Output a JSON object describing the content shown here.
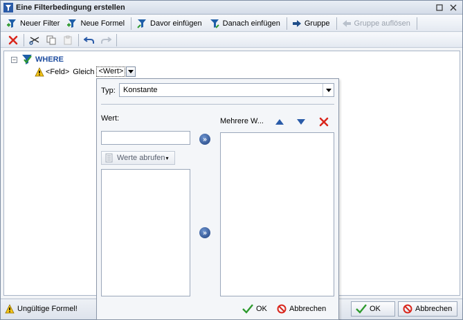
{
  "window": {
    "title": "Eine Filterbedingung erstellen",
    "restore_icon": "restore-icon",
    "close_icon": "close-icon"
  },
  "toolbar1": {
    "neuer_filter": "Neuer Filter",
    "neue_formel": "Neue Formel",
    "davor_einfuegen": "Davor einfügen",
    "danach_einfuegen": "Danach einfügen",
    "gruppe": "Gruppe",
    "gruppe_aufloesen": "Gruppe auflösen"
  },
  "toolbar2": {
    "icons": [
      "delete-icon",
      "cut-icon",
      "copy-icon",
      "paste-icon",
      "undo-icon",
      "redo-icon"
    ]
  },
  "tree": {
    "root_label": "WHERE",
    "expander": "−",
    "condition": {
      "field": "<Feld>",
      "operator": "Gleich",
      "value": "<Wert>"
    }
  },
  "popup": {
    "typ_label": "Typ:",
    "typ_value": "Konstante",
    "wert_label": "Wert:",
    "werte_abrufen": "Werte abrufen",
    "mehrere_label": "Mehrere W...",
    "add_symbol": "»",
    "ok": "OK",
    "abbrechen": "Abbrechen"
  },
  "status": {
    "message": "Ungültige Formel!",
    "ok": "OK",
    "abbrechen": "Abbrechen"
  },
  "colors": {
    "accent": "#1f4ea0",
    "filter_icon": "#1f5fa8",
    "green": "#2e9a2e",
    "red": "#d9261c"
  }
}
